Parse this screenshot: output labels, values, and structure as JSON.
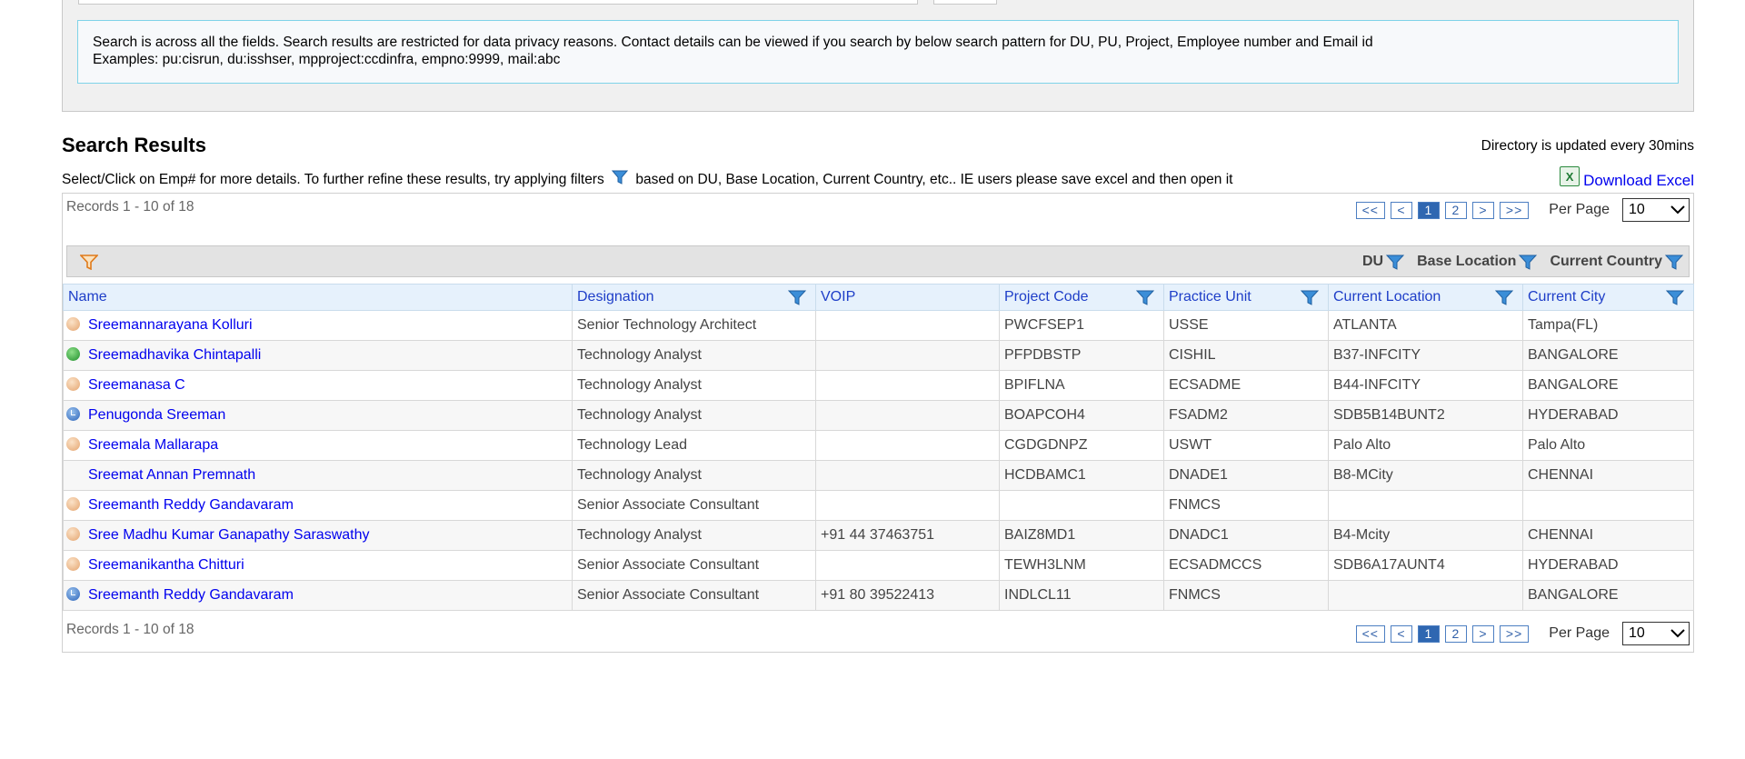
{
  "info": {
    "line1": "Search is across all the fields. Search results are restricted for data privacy reasons. Contact details can be viewed if you search by below search pattern for DU, PU, Project, Employee number and Email id",
    "line2": "Examples: pu:cisrun, du:isshser, mpproject:ccdinfra, empno:9999, mail:abc"
  },
  "results": {
    "title": "Search Results",
    "updated_note": "Directory is updated every 30mins",
    "instructions_before": "Select/Click on Emp# for more details. To further refine these results, try applying filters",
    "instructions_after": "based on DU, Base Location, Current Country, etc.. IE users please save excel and then open it",
    "download_label": "Download Excel",
    "excel_icon": "excel-icon",
    "records_text": "Records 1 - 10 of 18",
    "pager": {
      "first": "<<",
      "prev": "<",
      "pages": [
        "1",
        "2"
      ],
      "current": "1",
      "next": ">",
      "last": ">>",
      "per_page_label": "Per Page",
      "per_page_value": "10"
    },
    "filter_chips": [
      "DU",
      "Base Location",
      "Current Country"
    ],
    "columns": [
      "Name",
      "Designation",
      "VOIP",
      "Project Code",
      "Practice Unit",
      "Current Location",
      "Current City"
    ],
    "rows": [
      {
        "status": "away",
        "name": "Sreemannarayana Kolluri",
        "designation": "Senior Technology Architect",
        "voip": "",
        "project": "PWCFSEP1",
        "unit": "USSE",
        "location": "ATLANTA",
        "city": "Tampa(FL)"
      },
      {
        "status": "online",
        "name": "Sreemadhavika Chintapalli",
        "designation": "Technology Analyst",
        "voip": "",
        "project": "PFPDBSTP",
        "unit": "CISHIL",
        "location": "B37-INFCITY",
        "city": "BANGALORE"
      },
      {
        "status": "away",
        "name": "Sreemanasa C",
        "designation": "Technology Analyst",
        "voip": "",
        "project": "BPIFLNA",
        "unit": "ECSADME",
        "location": "B44-INFCITY",
        "city": "BANGALORE"
      },
      {
        "status": "busy",
        "name": "Penugonda Sreeman",
        "designation": "Technology Analyst",
        "voip": "",
        "project": "BOAPCOH4",
        "unit": "FSADM2",
        "location": "SDB5B14BUNT2",
        "city": "HYDERABAD"
      },
      {
        "status": "away",
        "name": "Sreemala Mallarapa",
        "designation": "Technology Lead",
        "voip": "",
        "project": "CGDGDNPZ",
        "unit": "USWT",
        "location": "Palo Alto",
        "city": "Palo Alto"
      },
      {
        "status": "none",
        "name": "Sreemat Annan Premnath",
        "designation": "Technology Analyst",
        "voip": "",
        "project": "HCDBAMC1",
        "unit": "DNADE1",
        "location": "B8-MCity",
        "city": "CHENNAI"
      },
      {
        "status": "away",
        "name": "Sreemanth Reddy Gandavaram",
        "designation": "Senior Associate Consultant",
        "voip": "",
        "project": "",
        "unit": "FNMCS",
        "location": "",
        "city": ""
      },
      {
        "status": "away",
        "name": "Sree Madhu Kumar Ganapathy Saraswathy",
        "designation": "Technology Analyst",
        "voip": "+91 44 37463751",
        "project": "BAIZ8MD1",
        "unit": "DNADC1",
        "location": "B4-Mcity",
        "city": "CHENNAI"
      },
      {
        "status": "away",
        "name": "Sreemanikantha Chitturi",
        "designation": "Senior Associate Consultant",
        "voip": "",
        "project": "TEWH3LNM",
        "unit": "ECSADMCCS",
        "location": "SDB6A17AUNT4",
        "city": "HYDERABAD"
      },
      {
        "status": "busy",
        "name": "Sreemanth Reddy Gandavaram",
        "designation": "Senior Associate Consultant",
        "voip": "+91 80 39522413",
        "project": "INDLCL11",
        "unit": "FNMCS",
        "location": "",
        "city": "BANGALORE"
      }
    ]
  }
}
